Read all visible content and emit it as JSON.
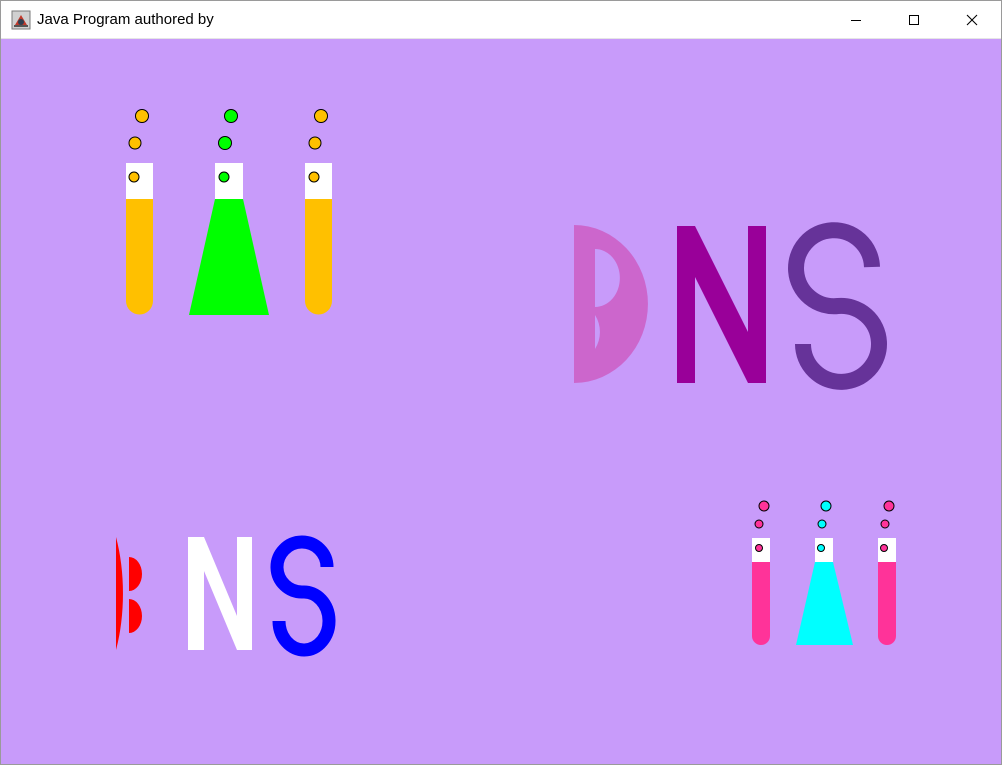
{
  "window": {
    "title": "Java Program authored by",
    "icon": "java-coffee-cup-icon",
    "controls": {
      "minimize": "minimize-icon",
      "maximize": "maximize-icon",
      "close": "close-icon"
    }
  },
  "canvas": {
    "background": "#c89bfa",
    "top_left_tubes": {
      "left_tube_liquid": "#ffc000",
      "flask_liquid": "#00ff00",
      "right_tube_liquid": "#ffc000",
      "tube_top": "#ffffff"
    },
    "top_right_letters": {
      "b": "#cc66cc",
      "n": "#990099",
      "s": "#663399"
    },
    "bottom_left_letters": {
      "b": "#ff0000",
      "n": "#ffffff",
      "s": "#0000ff"
    },
    "bottom_right_tubes": {
      "left_tube_liquid": "#ff3399",
      "flask_liquid": "#00ffff",
      "right_tube_liquid": "#ff3399",
      "tube_top": "#ffffff"
    }
  }
}
